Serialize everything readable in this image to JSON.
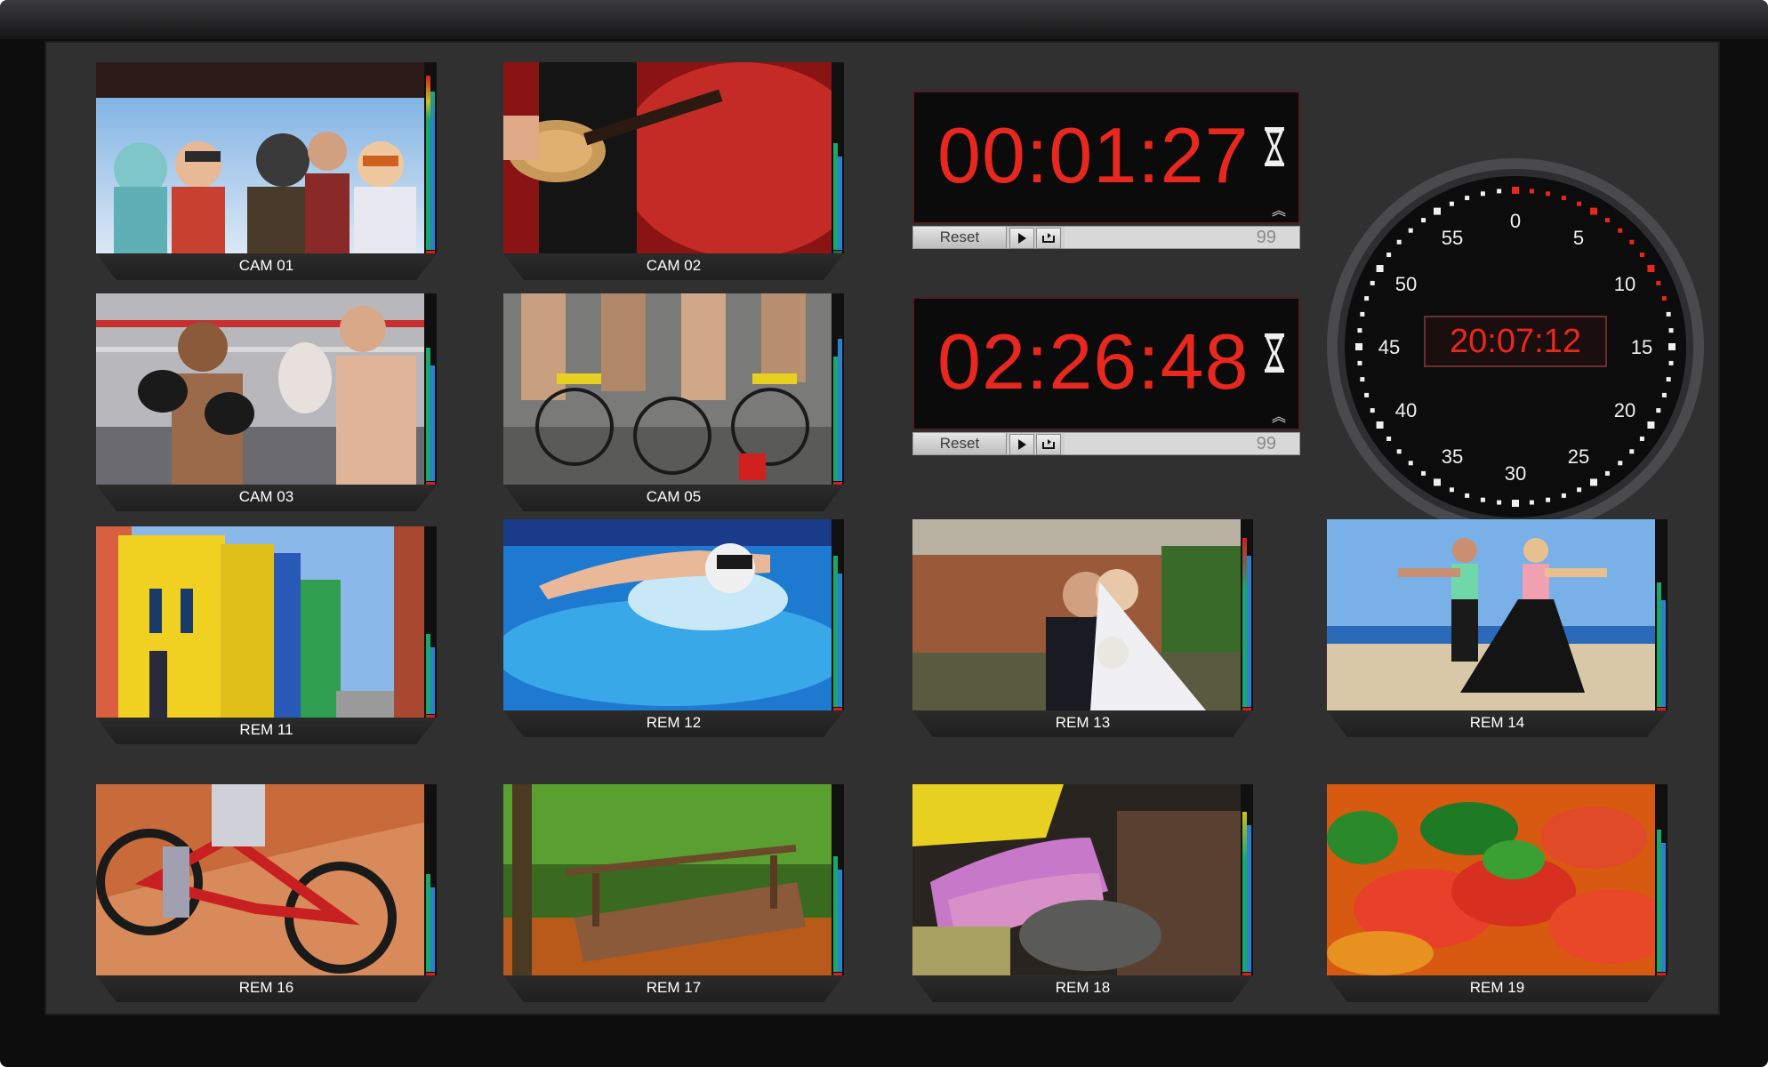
{
  "tiles": [
    {
      "label": "CAM 01"
    },
    {
      "label": "CAM 02"
    },
    {
      "label": "CAM 03"
    },
    {
      "label": "CAM 05"
    },
    {
      "label": "REM 11"
    },
    {
      "label": "REM 12"
    },
    {
      "label": "REM 13"
    },
    {
      "label": "REM 14"
    },
    {
      "label": "REM 16"
    },
    {
      "label": "REM 17"
    },
    {
      "label": "REM 18"
    },
    {
      "label": "REM 19"
    }
  ],
  "timers": [
    {
      "time": "00:01:27",
      "reset_label": "Reset",
      "count": "99"
    },
    {
      "time": "02:26:48",
      "reset_label": "Reset",
      "count": "99"
    }
  ],
  "clock": {
    "time": "20:07:12",
    "numerals": [
      "0",
      "5",
      "10",
      "15",
      "20",
      "25",
      "30",
      "35",
      "40",
      "45",
      "50",
      "55"
    ]
  },
  "colors": {
    "digit_red": "#e8271e",
    "screen_bg": "#303030",
    "meter_green": "#1aa86a",
    "meter_blue": "#2b7fd0",
    "meter_peak": "#d91c1c"
  }
}
